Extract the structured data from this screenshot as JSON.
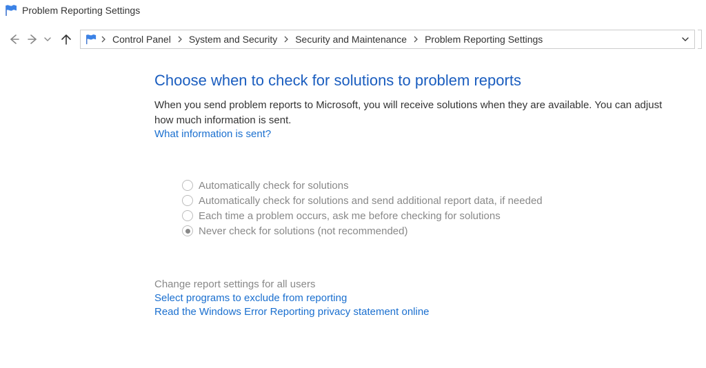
{
  "window": {
    "title": "Problem Reporting Settings"
  },
  "breadcrumbs": [
    "Control Panel",
    "System and Security",
    "Security and Maintenance",
    "Problem Reporting Settings"
  ],
  "main": {
    "heading": "Choose when to check for solutions to problem reports",
    "description": "When you send problem reports to Microsoft, you will receive solutions when they are available. You can adjust how much information is sent.",
    "info_link": "What information is sent?",
    "options": [
      "Automatically check for solutions",
      "Automatically check for solutions and send additional report data, if needed",
      "Each time a problem occurs, ask me before checking for solutions",
      "Never check for solutions (not recommended)"
    ],
    "selected_index": 3,
    "footer": {
      "all_users": "Change report settings for all users",
      "exclude": "Select programs to exclude from reporting",
      "privacy": "Read the Windows Error Reporting privacy statement online"
    }
  }
}
